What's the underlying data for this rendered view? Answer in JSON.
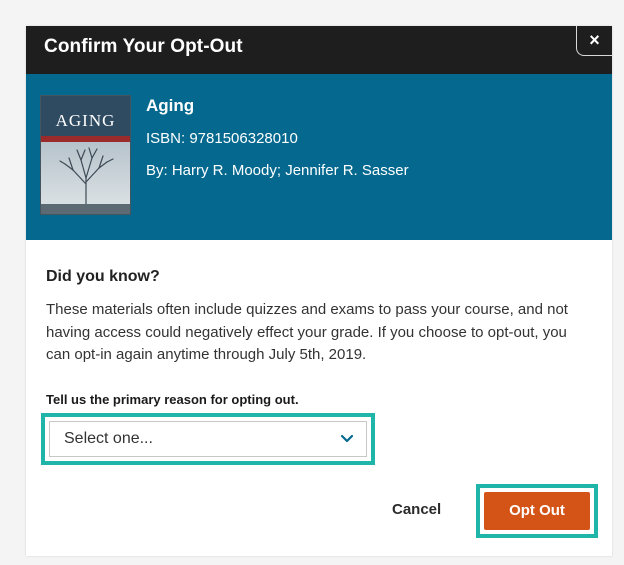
{
  "dialog": {
    "title": "Confirm Your Opt-Out",
    "close_label": "×"
  },
  "book": {
    "cover_text": "AGING",
    "title": "Aging",
    "isbn": "ISBN: 9781506328010",
    "authors": "By: Harry R. Moody; Jennifer R. Sasser"
  },
  "notice": {
    "heading": "Did you know?",
    "body": "These materials often include quizzes and exams to pass your course, and not having access could negatively effect your grade. If you choose to opt-out, you can opt-in again anytime through July 5th, 2019."
  },
  "reason": {
    "label": "Tell us the primary reason for opting out.",
    "selected": "Select one..."
  },
  "actions": {
    "cancel_label": "Cancel",
    "optout_label": "Opt Out"
  },
  "colors": {
    "header_bg": "#1e1e1e",
    "banner_bg": "#05698f",
    "highlight_outline": "#1fb5a8",
    "primary_button": "#d45417"
  },
  "icons": {
    "close": "close-icon",
    "select_chevron": "chevron-down-icon"
  }
}
